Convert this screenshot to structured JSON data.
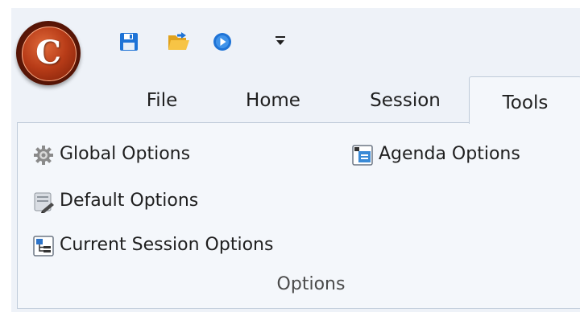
{
  "app": {
    "logo_letter": "C",
    "logo_icon": "app-logo-c",
    "accent": "#b83c18"
  },
  "quick_access": [
    {
      "name": "save",
      "icon": "floppy-disk-icon",
      "color": "#1e73d6"
    },
    {
      "name": "open",
      "icon": "open-folder-icon",
      "color": "#f2b630"
    },
    {
      "name": "run",
      "icon": "play-circle-icon",
      "color": "#1e73d6"
    },
    {
      "name": "customize",
      "icon": "customize-dropdown-icon"
    }
  ],
  "tabs": [
    {
      "label": "File",
      "active": false
    },
    {
      "label": "Home",
      "active": false
    },
    {
      "label": "Session",
      "active": false
    },
    {
      "label": "Tools",
      "active": true
    }
  ],
  "ribbon": {
    "group_label": "Options",
    "commands": [
      {
        "label": "Global Options",
        "icon": "gears-icon"
      },
      {
        "label": "Default Options",
        "icon": "default-options-icon"
      },
      {
        "label": "Current Session Options",
        "icon": "session-tree-icon"
      },
      {
        "label": "Agenda Options",
        "icon": "agenda-window-icon"
      }
    ]
  },
  "colors": {
    "panel_bg": "#f4f7fb",
    "frame_bg": "#eef2f8",
    "border": "#bfcbd9"
  }
}
